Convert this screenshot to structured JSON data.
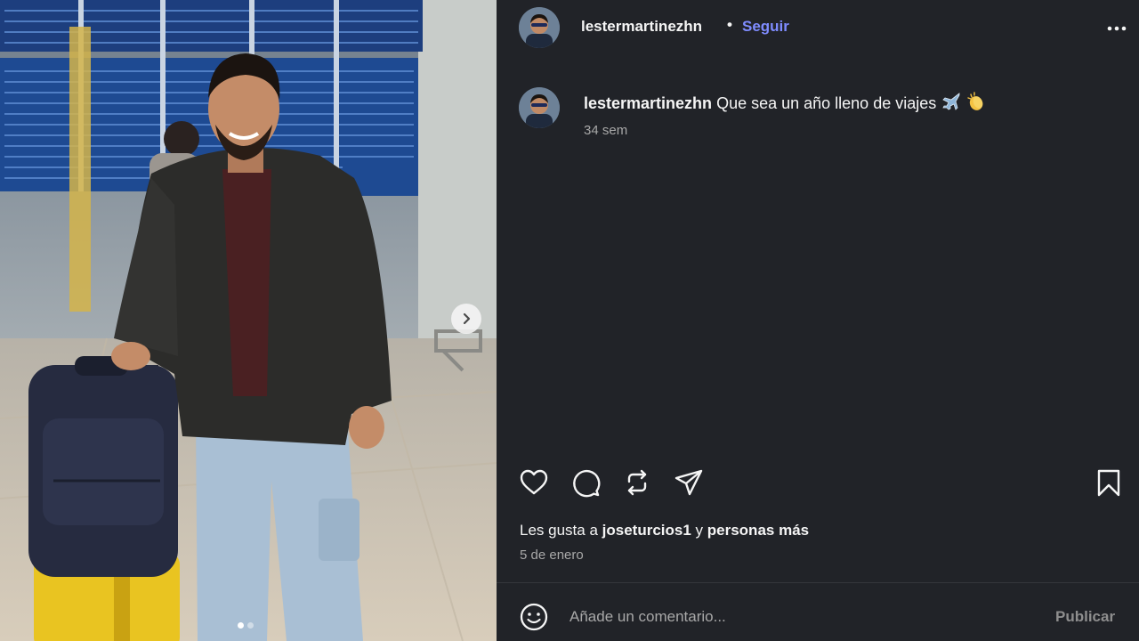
{
  "photo": {
    "alt_icon": "post-photo",
    "next_icon": "chevron-right-icon",
    "carousel_total": 2,
    "carousel_active": 1
  },
  "header": {
    "username": "lestermartinezhn",
    "separator": "•",
    "follow_label": "Seguir",
    "more_icon": "more-horizontal-icon"
  },
  "caption": {
    "username": "lestermartinezhn",
    "text": "Que sea un año lleno de viajes",
    "emojis": [
      "airplane-emoji",
      "clapping-hands-emoji"
    ],
    "time": "34 sem"
  },
  "actions": {
    "like_icon": "heart-icon",
    "comment_icon": "comment-icon",
    "repost_icon": "repost-icon",
    "share_icon": "send-icon",
    "save_icon": "bookmark-icon"
  },
  "likes": {
    "prefix": "Les gusta a",
    "user": "joseturcios1",
    "joiner": "y",
    "others": "personas más"
  },
  "date": "5 de enero",
  "comment": {
    "emoji_icon": "smiley-icon",
    "placeholder": "Añade un comentario...",
    "publish_label": "Publicar"
  },
  "colors": {
    "background": "#212328",
    "follow": "#7f8cff",
    "secondary_text": "#a8a8a8",
    "publish_disabled": "#8e8e8e"
  }
}
